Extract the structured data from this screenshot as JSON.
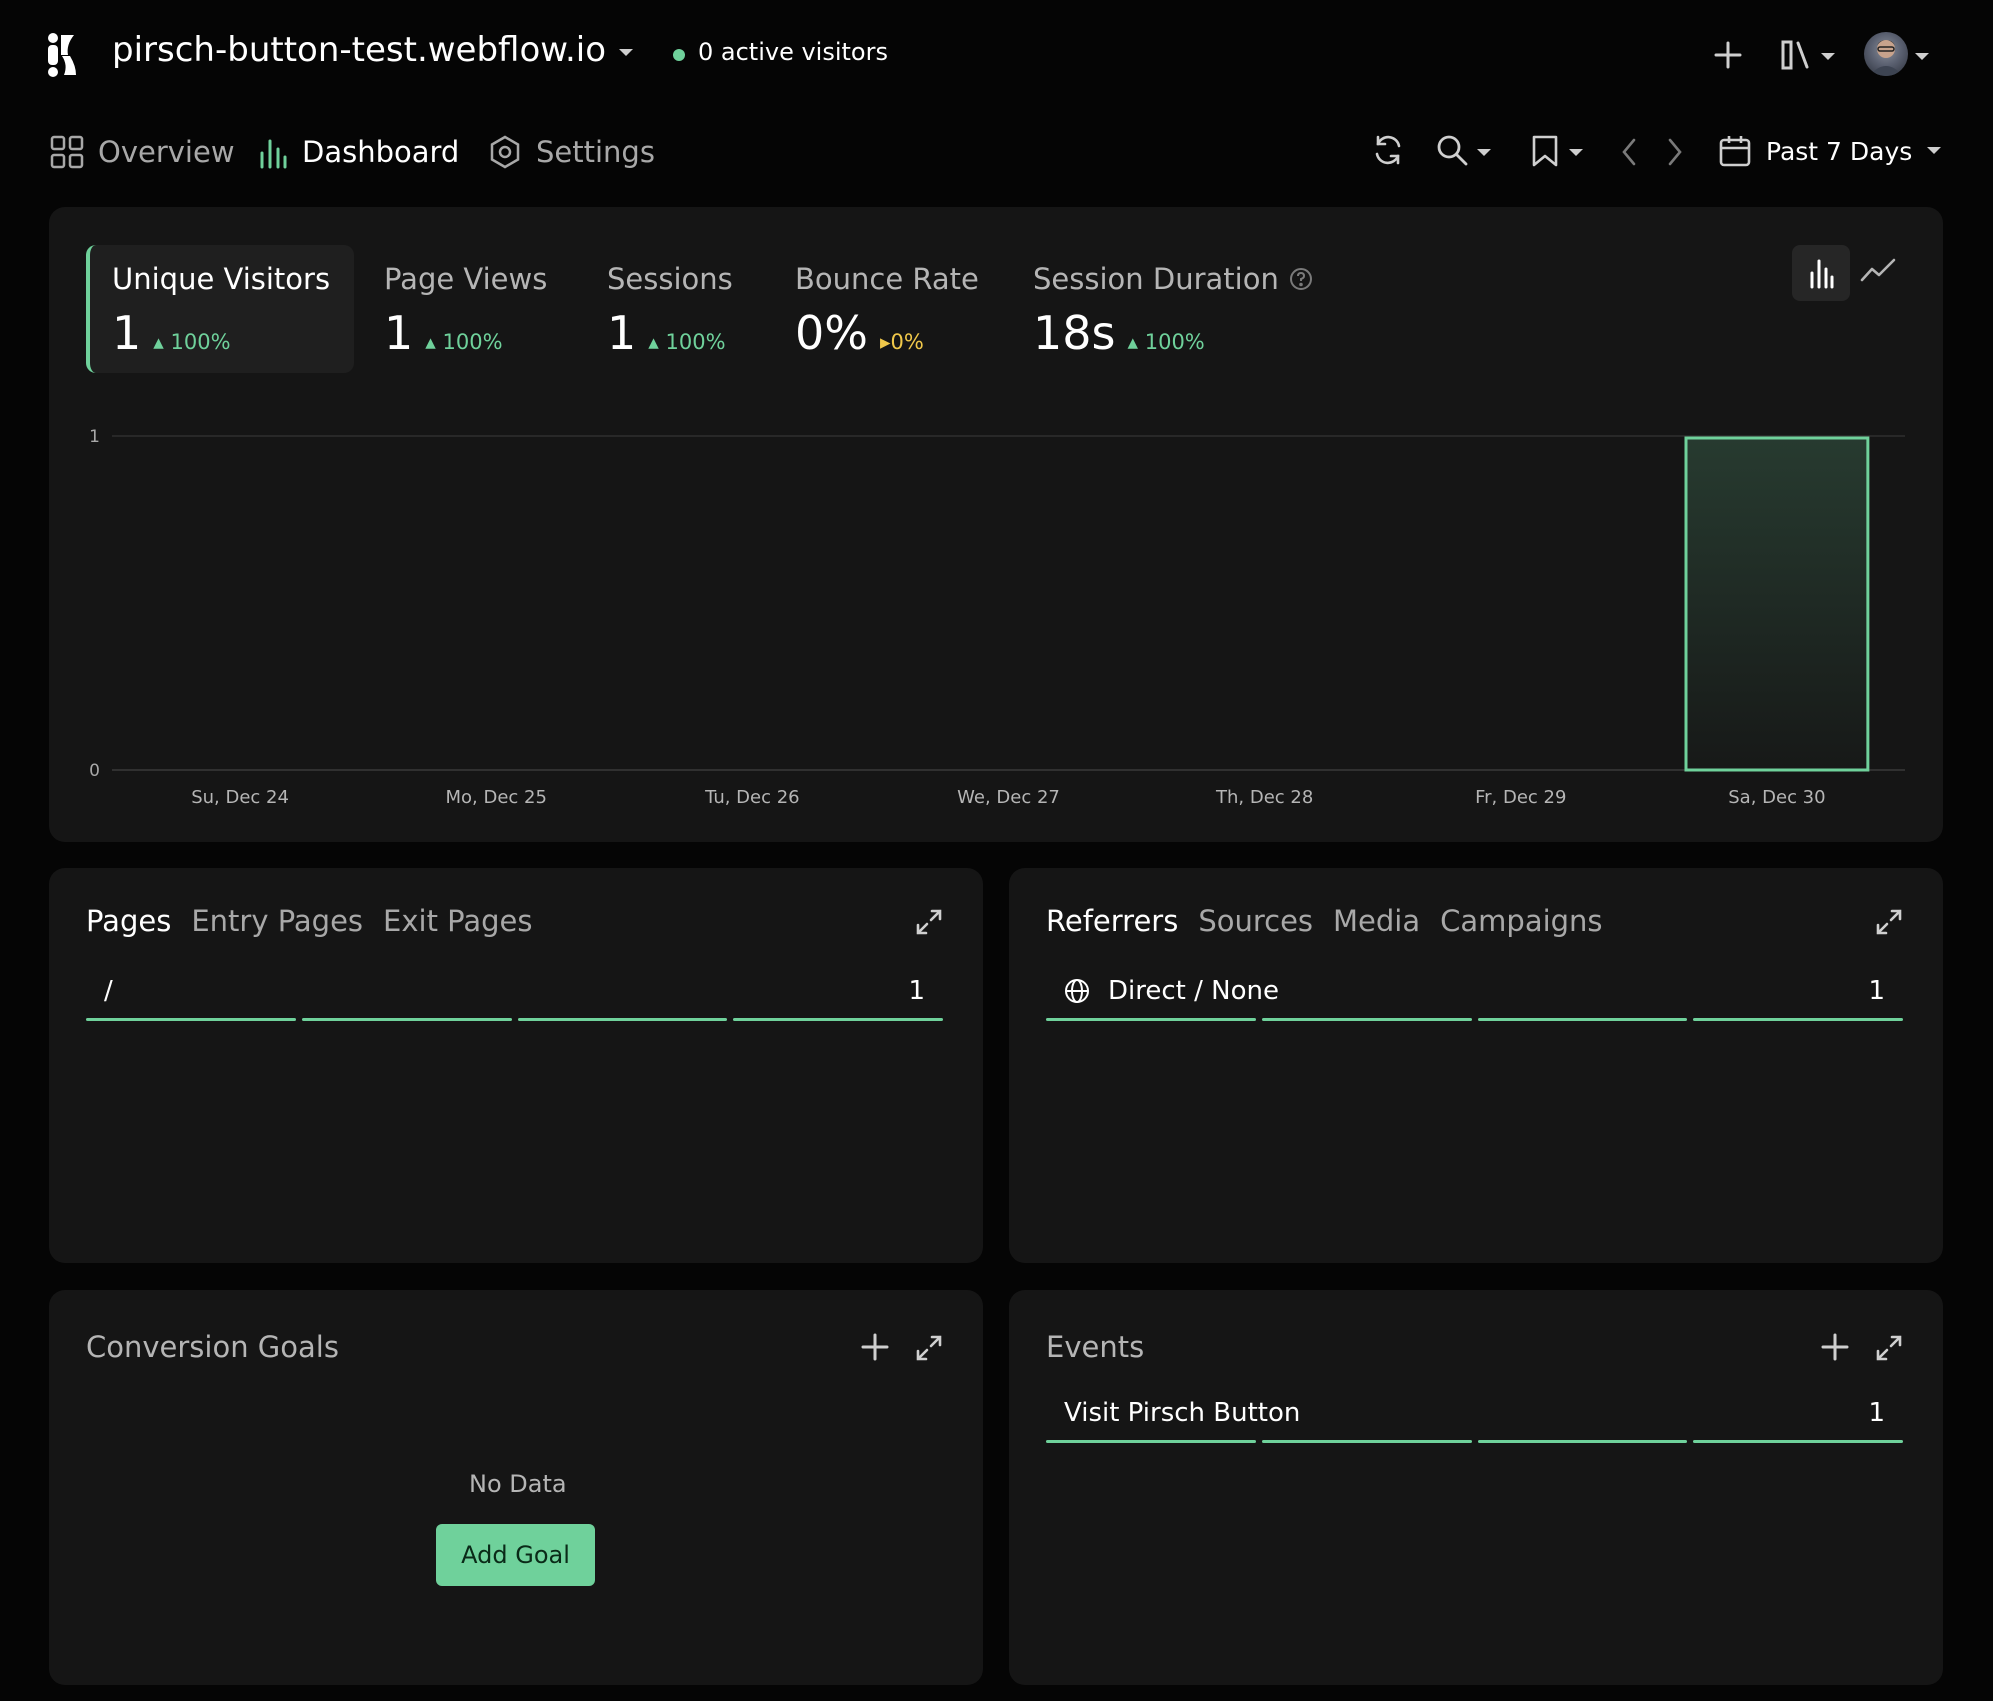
{
  "header": {
    "site_title": "pirsch-button-test.webflow.io",
    "active_visitors": "0 active visitors"
  },
  "nav": {
    "overview": "Overview",
    "dashboard": "Dashboard",
    "settings": "Settings",
    "date_range": "Past 7 Days"
  },
  "metrics": [
    {
      "label": "Unique Visitors",
      "value": "1",
      "change": "100%",
      "trend": "up"
    },
    {
      "label": "Page Views",
      "value": "1",
      "change": "100%",
      "trend": "up"
    },
    {
      "label": "Sessions",
      "value": "1",
      "change": "100%",
      "trend": "up"
    },
    {
      "label": "Bounce Rate",
      "value": "0%",
      "change": "0%",
      "trend": "neutral"
    },
    {
      "label": "Session Duration",
      "value": "18s",
      "change": "100%",
      "trend": "up"
    }
  ],
  "chart_data": {
    "type": "bar",
    "categories": [
      "Su, Dec 24",
      "Mo, Dec 25",
      "Tu, Dec 26",
      "We, Dec 27",
      "Th, Dec 28",
      "Fr, Dec 29",
      "Sa, Dec 30"
    ],
    "series": [
      {
        "values": [
          0,
          0,
          0,
          0,
          0,
          0,
          1
        ]
      }
    ],
    "yticks": [
      "0",
      "1"
    ],
    "ylim": [
      0,
      1
    ],
    "title": "",
    "xlabel": "",
    "ylabel": "",
    "color": "#6fd19b"
  },
  "pages_panel": {
    "tabs": [
      "Pages",
      "Entry Pages",
      "Exit Pages"
    ],
    "rows": [
      {
        "label": "/",
        "value": "1"
      }
    ]
  },
  "referrers_panel": {
    "tabs": [
      "Referrers",
      "Sources",
      "Media",
      "Campaigns"
    ],
    "rows": [
      {
        "label": "Direct / None",
        "value": "1"
      }
    ]
  },
  "goals_panel": {
    "title": "Conversion Goals",
    "empty_text": "No Data",
    "add_button": "Add Goal"
  },
  "events_panel": {
    "title": "Events",
    "rows": [
      {
        "label": "Visit Pirsch Button",
        "value": "1"
      }
    ]
  },
  "colors": {
    "accent": "#6fd19b",
    "neutral_trend": "#f0c84a",
    "background": "#050505",
    "card": "#151515"
  }
}
